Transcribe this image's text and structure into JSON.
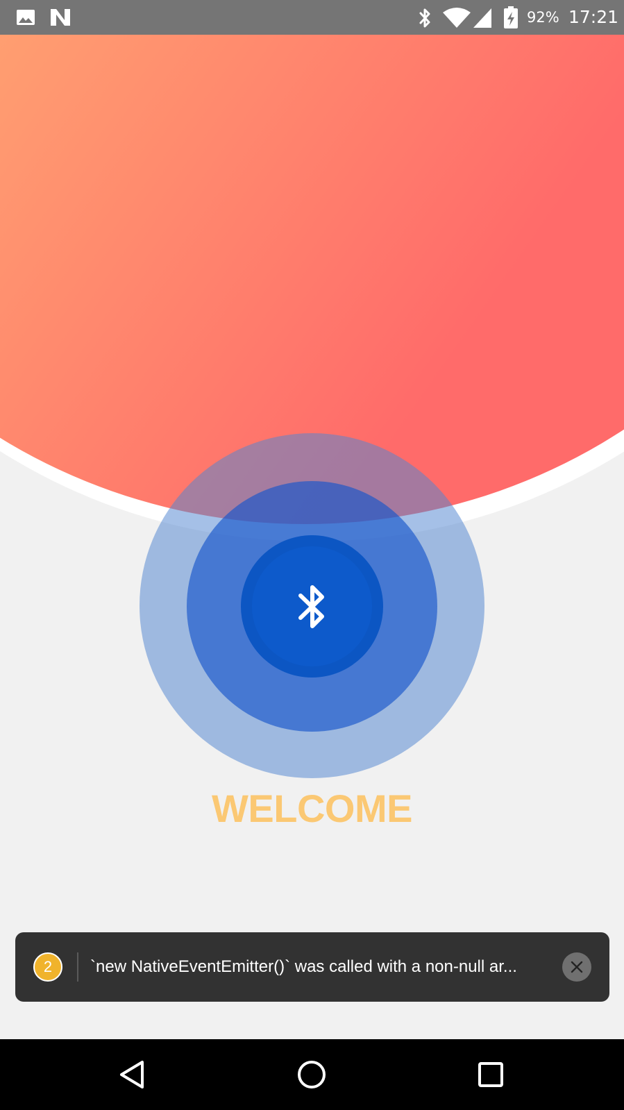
{
  "status_bar": {
    "icons": [
      "image-icon",
      "n-logo-icon",
      "bluetooth-icon",
      "wifi-icon",
      "cell-signal-icon",
      "battery-charging-icon"
    ],
    "battery": "92%",
    "time": "17:21"
  },
  "main": {
    "center_icon": "bluetooth-icon",
    "welcome": "WELCOME",
    "colors": {
      "gradient_start": "#ffb073",
      "gradient_end": "#ff6b6a",
      "ring_core": "#0d5acb",
      "welcome_text": "#fbc873"
    }
  },
  "toast": {
    "count": "2",
    "message": "`new NativeEventEmitter()` was called with a non-null ar...",
    "badge_color": "#f0b32c"
  },
  "nav_bar": {
    "buttons": [
      "back-icon",
      "home-icon",
      "recents-icon"
    ]
  }
}
